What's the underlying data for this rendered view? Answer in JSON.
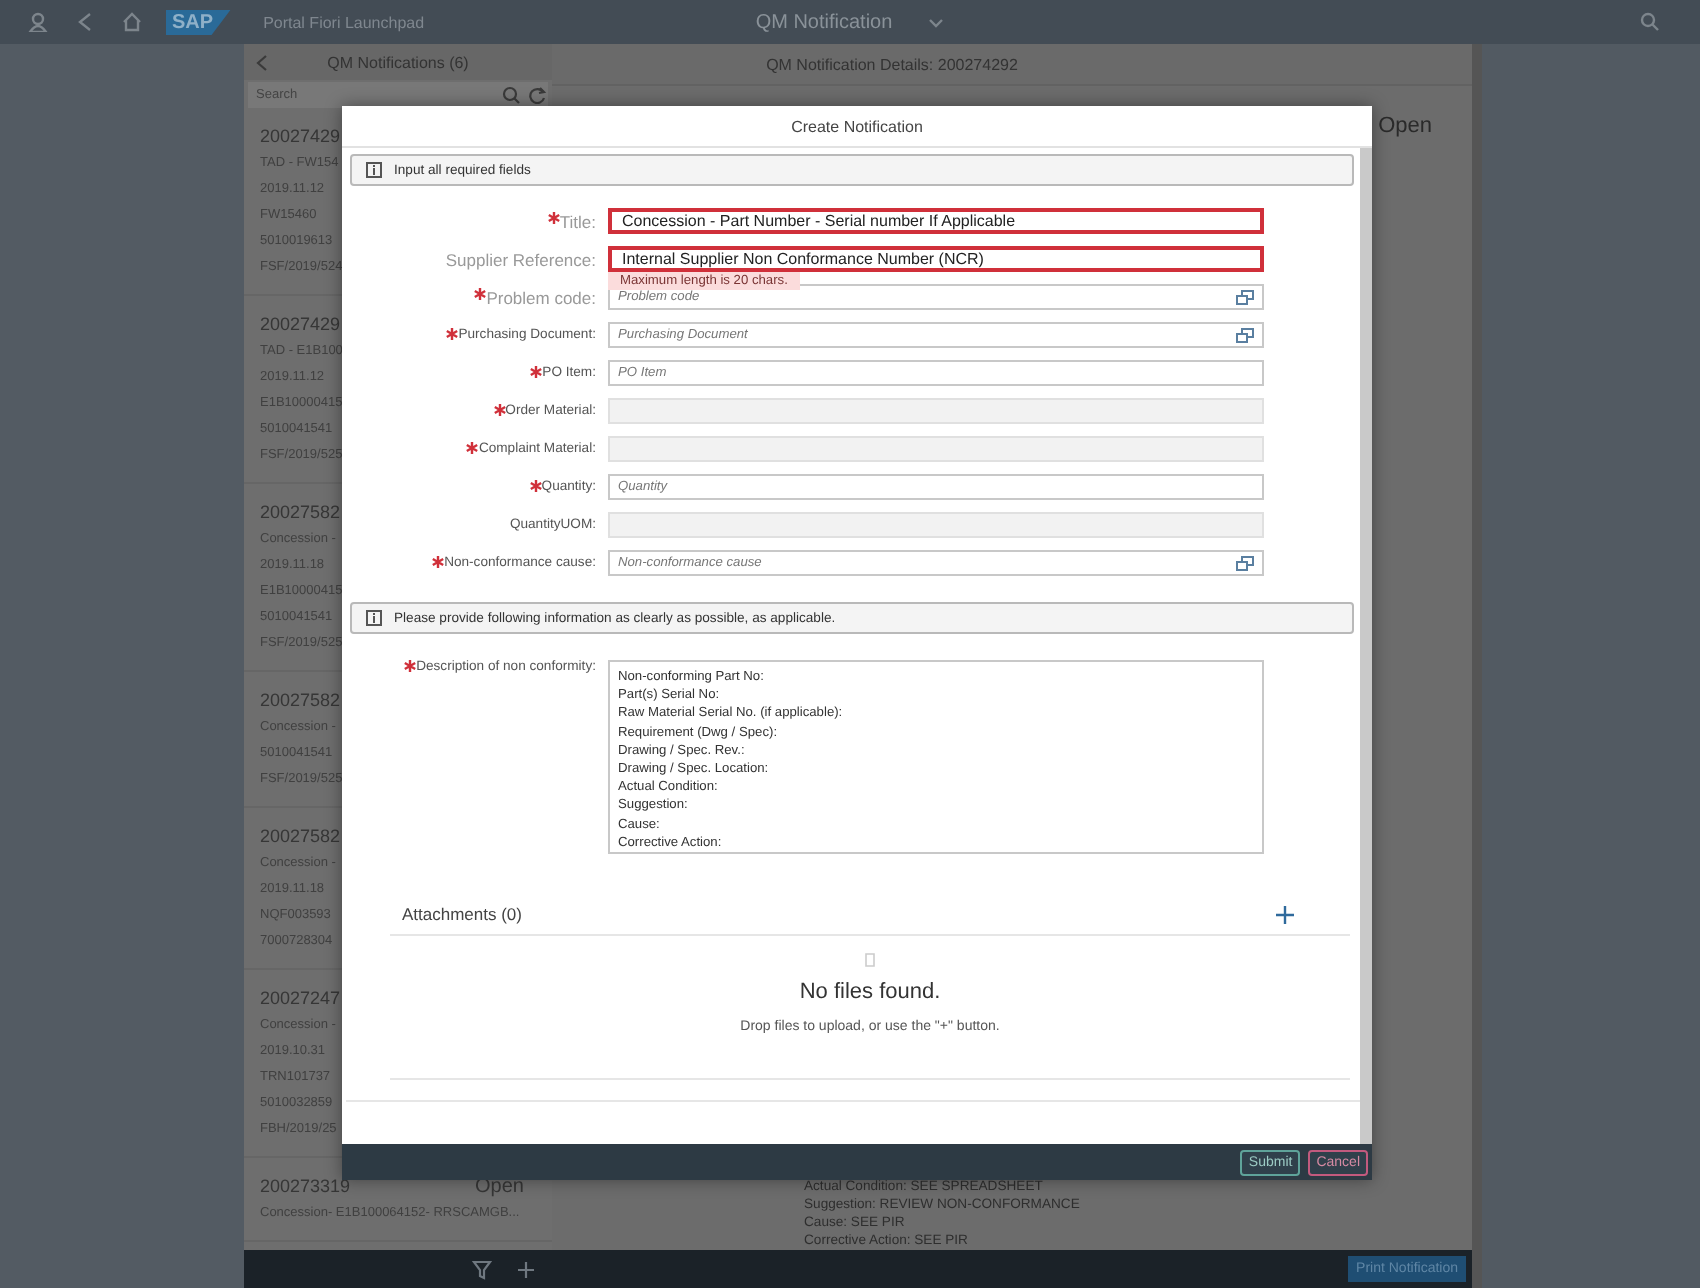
{
  "shell": {
    "logo": "SAP",
    "title": "Portal Fiori Launchpad",
    "app_title": "QM Notification"
  },
  "master": {
    "title": "QM Notifications (6)",
    "search": {
      "placeholder": "Search"
    },
    "items": [
      {
        "number": "20027429",
        "lines": [
          "TAD - FW154",
          "2019.11.12",
          "FW15460",
          "5010019613",
          "FSF/2019/524"
        ]
      },
      {
        "number": "20027429",
        "lines": [
          "TAD - E1B100",
          "2019.11.12",
          "E1B10000415",
          "5010041541",
          "FSF/2019/525"
        ]
      },
      {
        "number": "20027582",
        "lines": [
          "Concession - ",
          "2019.11.18",
          "E1B10000415",
          "5010041541",
          "FSF/2019/525"
        ]
      },
      {
        "number": "20027582",
        "lines": [
          "Concession - ",
          "5010041541",
          "FSF/2019/525"
        ]
      },
      {
        "number": "20027582",
        "lines": [
          "Concession - ",
          "2019.11.18",
          "NQF003593",
          "7000728304"
        ]
      },
      {
        "number": "20027247",
        "lines": [
          "Concession - ",
          "2019.10.31",
          "TRN101737",
          "5010032859",
          "FBH/2019/25"
        ]
      },
      {
        "number": "200273319",
        "status": "Open",
        "lines": [
          "Concession- E1B100064152- RRSCAMGB..."
        ]
      }
    ]
  },
  "detail": {
    "title": "QM Notification Details: 200274292",
    "status": "Open",
    "lines": [
      "Actual Condition: SEE SPREADSHEET",
      "Suggestion: REVIEW NON-CONFORMANCE",
      "Cause: SEE PIR",
      "Corrective Action: SEE PIR"
    ],
    "print_button": "Print Notification"
  },
  "dialog": {
    "title": "Create Notification",
    "info": "Input all required fields",
    "fields": [
      {
        "label": "Title:",
        "required": true,
        "value": "Concession - Part Number - Serial number If Applicable",
        "error": true,
        "disabled": false,
        "value_help": false
      },
      {
        "label": "Supplier Reference:",
        "required": false,
        "value": "Internal Supplier Non Conformance Number (NCR)",
        "error": true,
        "message": "Maximum length is 20 chars.",
        "disabled": false,
        "value_help": false
      },
      {
        "label": "Problem code:",
        "required": true,
        "placeholder": "Problem code",
        "error": false,
        "disabled": false,
        "value_help": true
      },
      {
        "label": "Purchasing Document:",
        "required": true,
        "placeholder": "Purchasing Document",
        "error": false,
        "disabled": false,
        "value_help": true
      },
      {
        "label": "PO Item:",
        "required": true,
        "placeholder": "PO Item",
        "error": false,
        "disabled": false,
        "value_help": false
      },
      {
        "label": "Order Material:",
        "required": true,
        "error": false,
        "disabled": true,
        "value_help": false
      },
      {
        "label": "Complaint Material:",
        "required": true,
        "error": false,
        "disabled": true,
        "value_help": false
      },
      {
        "label": "Quantity:",
        "required": true,
        "placeholder": "Quantity",
        "error": false,
        "disabled": false,
        "value_help": false
      },
      {
        "label": "QuantityUOM:",
        "required": false,
        "error": false,
        "disabled": true,
        "value_help": false
      },
      {
        "label": "Non-conformance cause:",
        "required": true,
        "placeholder": "Non-conformance cause",
        "error": false,
        "disabled": false,
        "value_help": true
      }
    ],
    "note": "Please provide following information as clearly as possible, as applicable.",
    "description": {
      "label": "Description of non conformity:",
      "required": true,
      "value": "Non-conforming Part No:\nPart(s) Serial No:\nRaw Material Serial No. (if applicable):\nRequirement (Dwg / Spec):\nDrawing / Spec. Rev.:\nDrawing / Spec. Location:\nActual Condition:\nSuggestion:\nCause:\nCorrective Action:"
    },
    "attachments": {
      "title": "Attachments (0)",
      "empty_title": "No files found.",
      "empty_text": "Drop files to upload, or use the \"+\" button."
    },
    "buttons": [
      {
        "label": "Submit",
        "kind": "accept"
      },
      {
        "label": "Cancel",
        "kind": "reject"
      }
    ]
  }
}
